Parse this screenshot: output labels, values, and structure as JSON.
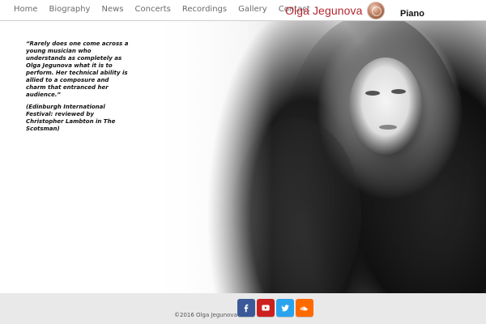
{
  "nav": {
    "items": [
      {
        "label": "Home"
      },
      {
        "label": "Biography"
      },
      {
        "label": "News"
      },
      {
        "label": "Concerts"
      },
      {
        "label": "Recordings"
      },
      {
        "label": "Gallery"
      },
      {
        "label": "Contact"
      }
    ]
  },
  "brand": {
    "name": "Olga Jegunova",
    "subtitle": "Piano",
    "accent": "#b3262f"
  },
  "quote": {
    "text": "“Rarely does one come across a young musician who understands as completely as Olga Jegunova what it is to perform. Her technical ability is allied to a composure and charm that entranced her audience.”",
    "source": "(Edinburgh International Festival: reviewed by Christopher Lambton in The Scotsman)"
  },
  "footer": {
    "copyright": "©2016 Olga Jegunova",
    "social": [
      {
        "icon": "facebook-icon"
      },
      {
        "icon": "youtube-icon"
      },
      {
        "icon": "twitter-icon"
      },
      {
        "icon": "soundcloud-icon"
      }
    ]
  },
  "colors": {
    "nav_text": "#6b6b6b",
    "footer_bg": "#e9e9e9",
    "facebook": "#3b5998",
    "youtube": "#cc1f1f",
    "twitter": "#2aa3ef",
    "soundcloud": "#ff6a00"
  }
}
